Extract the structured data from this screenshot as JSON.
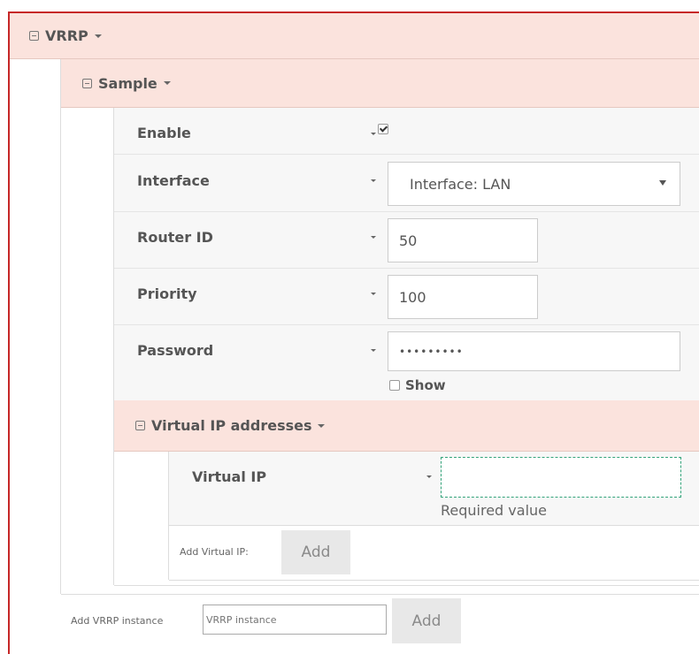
{
  "vrrp": {
    "title": "VRRP",
    "instance": {
      "title": "Sample",
      "fields": {
        "enable": {
          "label": "Enable",
          "checked": true
        },
        "interface": {
          "label": "Interface",
          "value": "Interface: LAN"
        },
        "router_id": {
          "label": "Router ID",
          "value": "50"
        },
        "priority": {
          "label": "Priority",
          "value": "100"
        },
        "password": {
          "label": "Password",
          "value": "•••••••••",
          "show_label": "Show"
        }
      },
      "virtual_ips": {
        "title": "Virtual IP addresses",
        "field_label": "Virtual IP",
        "field_value": "",
        "error": "Required value",
        "add_label": "Add Virtual IP:",
        "add_button": "Add"
      }
    },
    "add_instance": {
      "label": "Add VRRP instance",
      "placeholder": "VRRP instance",
      "button": "Add"
    }
  },
  "colors": {
    "frame_border": "#c62828",
    "header_bg": "#fbe3dd",
    "button_bg": "#e8e8e8"
  }
}
